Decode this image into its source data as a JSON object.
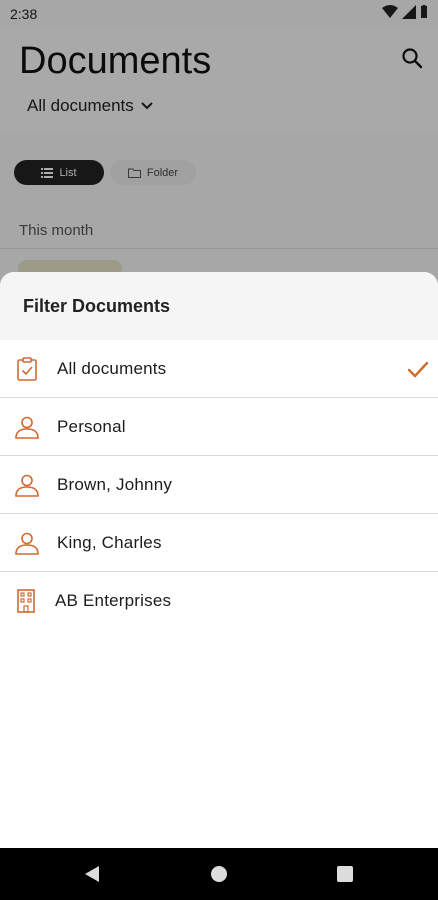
{
  "status": {
    "time": "2:38"
  },
  "header": {
    "title": "Documents",
    "filter_label": "All documents"
  },
  "view_toggle": {
    "list_label": "List",
    "folder_label": "Folder"
  },
  "section": {
    "label": "This month"
  },
  "sheet": {
    "title": "Filter Documents",
    "options": [
      {
        "label": "All documents",
        "icon": "clipboard-check-icon",
        "selected": true
      },
      {
        "label": "Personal",
        "icon": "person-icon"
      },
      {
        "label": "Brown, Johnny",
        "icon": "person-icon"
      },
      {
        "label": "King, Charles",
        "icon": "person-icon"
      },
      {
        "label": "AB Enterprises",
        "icon": "building-icon"
      }
    ]
  },
  "colors": {
    "accent": "#d2692e",
    "scrim": "rgba(0,0,0,0.32)"
  }
}
